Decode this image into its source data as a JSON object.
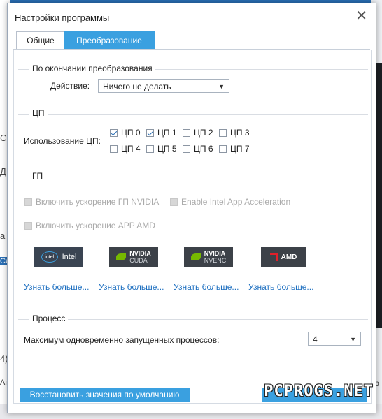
{
  "dialog": {
    "title": "Настройки программы",
    "close_glyph": "✕"
  },
  "tabs": [
    {
      "label": "Общие",
      "active": false
    },
    {
      "label": "Преобразование",
      "active": true
    }
  ],
  "after_conversion": {
    "group_title": "По окончании преобразования",
    "action_label": "Действие:",
    "action_value": "Ничего не делать"
  },
  "cpu": {
    "group_title": "ЦП",
    "usage_label": "Использование ЦП:",
    "cores": [
      {
        "label": "ЦП 0",
        "checked": true
      },
      {
        "label": "ЦП 1",
        "checked": true
      },
      {
        "label": "ЦП 2",
        "checked": false
      },
      {
        "label": "ЦП 3",
        "checked": false
      },
      {
        "label": "ЦП 4",
        "checked": false
      },
      {
        "label": "ЦП 5",
        "checked": false
      },
      {
        "label": "ЦП 6",
        "checked": false
      },
      {
        "label": "ЦП 7",
        "checked": false
      }
    ]
  },
  "gpu": {
    "group_title": "ГП",
    "nvidia_label": "Включить ускорение ГП NVIDIA",
    "intel_label": "Enable Intel App Acceleration",
    "amd_label": "Включить ускорение APP AMD",
    "logos": [
      {
        "icon": "intel-logo",
        "mark": "intel",
        "text": "Intel"
      },
      {
        "icon": "nvidia-cuda-logo",
        "text": "NVIDIA",
        "sub": "CUDA"
      },
      {
        "icon": "nvidia-nvenc-logo",
        "text": "NVIDIA",
        "sub": "NVENC"
      },
      {
        "icon": "amd-logo",
        "text": "AMD"
      }
    ],
    "learn_more": [
      "Узнать больше...",
      "Узнать больше...",
      "Узнать больше...",
      "Узнать больше..."
    ]
  },
  "process": {
    "group_title": "Процесс",
    "max_label": "Максимум одновременно запущенных процессов:",
    "max_value": "4"
  },
  "buttons": {
    "restore_defaults": "Восстановить значения по умолчанию"
  },
  "watermark": "PCPROGS.NET",
  "background": {
    "left_fragments": [
      "С",
      "Д",
      "а",
      "Сл",
      "4)",
      "Ап"
    ],
    "right_fragments": [
      "ф"
    ]
  },
  "colors": {
    "accent": "#3aa0e0",
    "link": "#1d6fc0",
    "desktop": "#2a6fb5"
  }
}
